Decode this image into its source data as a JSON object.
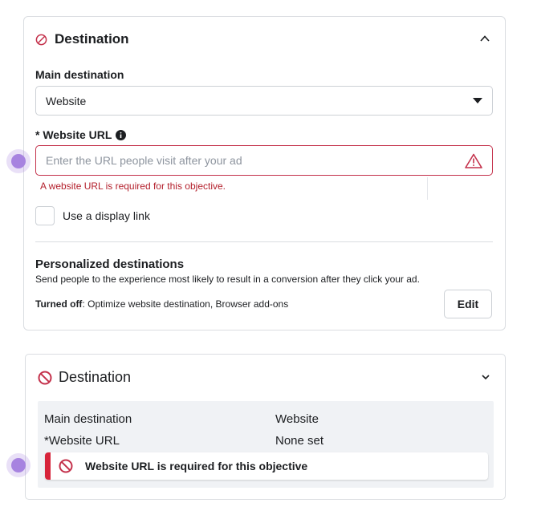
{
  "colors": {
    "error": "#c4314b",
    "error_text": "#b31f2b",
    "accent_dot": "#a783e0"
  },
  "panel": {
    "title": "Destination",
    "icon": "ban-icon",
    "toggle_icon": "chevron-up-icon",
    "main_destination": {
      "label": "Main destination",
      "value": "Website",
      "icon": "caret-down-icon"
    },
    "website_url": {
      "label": "* Website URL",
      "info_icon": "info-icon",
      "placeholder": "Enter the URL people visit after your ad",
      "warning_icon": "warning-icon",
      "error": "A website URL is required for this objective."
    },
    "display_link": {
      "label": "Use a display link",
      "checked": false
    },
    "personalized": {
      "title": "Personalized destinations",
      "description": "Send people to the experience most likely to result in a conversion after they click your ad.",
      "status_label": "Turned off",
      "status_detail": ": Optimize website destination, Browser add-ons",
      "edit_label": "Edit"
    }
  },
  "summary_panel": {
    "title": "Destination",
    "icon": "ban-icon",
    "toggle_icon": "chevron-down-icon",
    "rows": [
      {
        "label": "Main destination",
        "value": "Website"
      },
      {
        "label": "*Website URL",
        "value": "None set"
      }
    ],
    "error_banner": "Website URL is required for this objective"
  }
}
